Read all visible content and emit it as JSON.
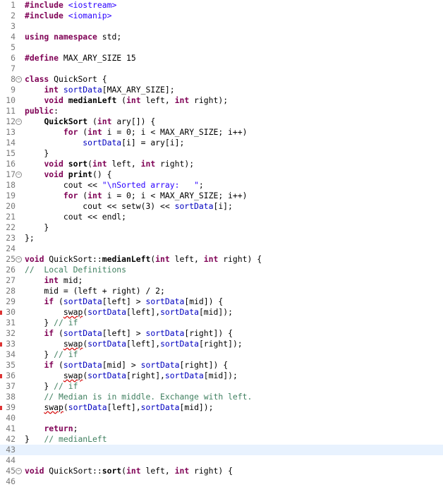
{
  "editor": {
    "lines": [
      {
        "n": "1",
        "fold": false,
        "marker": false,
        "current": false,
        "tokens": [
          [
            "pp",
            "#include"
          ],
          [
            "t",
            " "
          ],
          [
            "inc",
            "<iostream>"
          ]
        ]
      },
      {
        "n": "2",
        "fold": false,
        "marker": false,
        "current": false,
        "tokens": [
          [
            "pp",
            "#include"
          ],
          [
            "t",
            " "
          ],
          [
            "inc",
            "<iomanip>"
          ]
        ]
      },
      {
        "n": "3",
        "fold": false,
        "marker": false,
        "current": false,
        "tokens": []
      },
      {
        "n": "4",
        "fold": false,
        "marker": false,
        "current": false,
        "tokens": [
          [
            "kw",
            "using"
          ],
          [
            "t",
            " "
          ],
          [
            "kw",
            "namespace"
          ],
          [
            "t",
            " std;"
          ]
        ]
      },
      {
        "n": "5",
        "fold": false,
        "marker": false,
        "current": false,
        "tokens": []
      },
      {
        "n": "6",
        "fold": false,
        "marker": false,
        "current": false,
        "tokens": [
          [
            "pp",
            "#define"
          ],
          [
            "t",
            " MAX_ARY_SIZE 15"
          ]
        ]
      },
      {
        "n": "7",
        "fold": false,
        "marker": false,
        "current": false,
        "tokens": []
      },
      {
        "n": "8",
        "fold": true,
        "marker": false,
        "current": false,
        "tokens": [
          [
            "kw",
            "class"
          ],
          [
            "t",
            " QuickSort {"
          ]
        ]
      },
      {
        "n": "9",
        "fold": false,
        "marker": false,
        "current": false,
        "tokens": [
          [
            "t",
            "    "
          ],
          [
            "kw",
            "int"
          ],
          [
            "t",
            " "
          ],
          [
            "fld",
            "sortData"
          ],
          [
            "t",
            "["
          ],
          [
            "mac",
            "MAX_ARY_SIZE"
          ],
          [
            "t",
            "];"
          ]
        ]
      },
      {
        "n": "10",
        "fold": false,
        "marker": false,
        "current": false,
        "tokens": [
          [
            "t",
            "    "
          ],
          [
            "kw",
            "void"
          ],
          [
            "t",
            " "
          ],
          [
            "fn",
            "medianLeft"
          ],
          [
            "t",
            " ("
          ],
          [
            "kw",
            "int"
          ],
          [
            "t",
            " left, "
          ],
          [
            "kw",
            "int"
          ],
          [
            "t",
            " right);"
          ]
        ]
      },
      {
        "n": "11",
        "fold": false,
        "marker": false,
        "current": false,
        "tokens": [
          [
            "kw",
            "public"
          ],
          [
            "t",
            ":"
          ]
        ]
      },
      {
        "n": "12",
        "fold": true,
        "marker": false,
        "current": false,
        "tokens": [
          [
            "t",
            "    "
          ],
          [
            "fn",
            "QuickSort"
          ],
          [
            "t",
            " ("
          ],
          [
            "kw",
            "int"
          ],
          [
            "t",
            " ary[]) {"
          ]
        ]
      },
      {
        "n": "13",
        "fold": false,
        "marker": false,
        "current": false,
        "tokens": [
          [
            "t",
            "        "
          ],
          [
            "kw",
            "for"
          ],
          [
            "t",
            " ("
          ],
          [
            "kw",
            "int"
          ],
          [
            "t",
            " i = 0; i < "
          ],
          [
            "mac",
            "MAX_ARY_SIZE"
          ],
          [
            "t",
            "; i++)"
          ]
        ]
      },
      {
        "n": "14",
        "fold": false,
        "marker": false,
        "current": false,
        "tokens": [
          [
            "t",
            "            "
          ],
          [
            "fld",
            "sortData"
          ],
          [
            "t",
            "[i] = ary[i];"
          ]
        ]
      },
      {
        "n": "15",
        "fold": false,
        "marker": false,
        "current": false,
        "tokens": [
          [
            "t",
            "    }"
          ]
        ]
      },
      {
        "n": "16",
        "fold": false,
        "marker": false,
        "current": false,
        "tokens": [
          [
            "t",
            "    "
          ],
          [
            "kw",
            "void"
          ],
          [
            "t",
            " "
          ],
          [
            "fn",
            "sort"
          ],
          [
            "t",
            "("
          ],
          [
            "kw",
            "int"
          ],
          [
            "t",
            " left, "
          ],
          [
            "kw",
            "int"
          ],
          [
            "t",
            " right);"
          ]
        ]
      },
      {
        "n": "17",
        "fold": true,
        "marker": false,
        "current": false,
        "tokens": [
          [
            "t",
            "    "
          ],
          [
            "kw",
            "void"
          ],
          [
            "t",
            " "
          ],
          [
            "fn",
            "print"
          ],
          [
            "t",
            "() {"
          ]
        ]
      },
      {
        "n": "18",
        "fold": false,
        "marker": false,
        "current": false,
        "tokens": [
          [
            "t",
            "        cout << "
          ],
          [
            "str",
            "\"\\nSorted array:   \""
          ],
          [
            "t",
            ";"
          ]
        ]
      },
      {
        "n": "19",
        "fold": false,
        "marker": false,
        "current": false,
        "tokens": [
          [
            "t",
            "        "
          ],
          [
            "kw",
            "for"
          ],
          [
            "t",
            " ("
          ],
          [
            "kw",
            "int"
          ],
          [
            "t",
            " i = 0; i < "
          ],
          [
            "mac",
            "MAX_ARY_SIZE"
          ],
          [
            "t",
            "; i++)"
          ]
        ]
      },
      {
        "n": "20",
        "fold": false,
        "marker": false,
        "current": false,
        "tokens": [
          [
            "t",
            "            cout << setw(3) << "
          ],
          [
            "fld",
            "sortData"
          ],
          [
            "t",
            "[i];"
          ]
        ]
      },
      {
        "n": "21",
        "fold": false,
        "marker": false,
        "current": false,
        "tokens": [
          [
            "t",
            "        cout << endl;"
          ]
        ]
      },
      {
        "n": "22",
        "fold": false,
        "marker": false,
        "current": false,
        "tokens": [
          [
            "t",
            "    }"
          ]
        ]
      },
      {
        "n": "23",
        "fold": false,
        "marker": false,
        "current": false,
        "tokens": [
          [
            "t",
            "};"
          ]
        ]
      },
      {
        "n": "24",
        "fold": false,
        "marker": false,
        "current": false,
        "tokens": []
      },
      {
        "n": "25",
        "fold": true,
        "marker": false,
        "current": false,
        "tokens": [
          [
            "kw",
            "void"
          ],
          [
            "t",
            " QuickSort::"
          ],
          [
            "fn",
            "medianLeft"
          ],
          [
            "t",
            "("
          ],
          [
            "kw",
            "int"
          ],
          [
            "t",
            " left, "
          ],
          [
            "kw",
            "int"
          ],
          [
            "t",
            " right) {"
          ]
        ]
      },
      {
        "n": "26",
        "fold": false,
        "marker": false,
        "current": false,
        "tokens": [
          [
            "cmt",
            "//  Local Definitions"
          ]
        ]
      },
      {
        "n": "27",
        "fold": false,
        "marker": false,
        "current": false,
        "tokens": [
          [
            "t",
            "    "
          ],
          [
            "kw",
            "int"
          ],
          [
            "t",
            " mid;"
          ]
        ]
      },
      {
        "n": "28",
        "fold": false,
        "marker": false,
        "current": false,
        "tokens": [
          [
            "t",
            "    mid = (left + right) / 2;"
          ]
        ]
      },
      {
        "n": "29",
        "fold": false,
        "marker": false,
        "current": false,
        "tokens": [
          [
            "t",
            "    "
          ],
          [
            "kw",
            "if"
          ],
          [
            "t",
            " ("
          ],
          [
            "fld",
            "sortData"
          ],
          [
            "t",
            "[left] > "
          ],
          [
            "fld",
            "sortData"
          ],
          [
            "t",
            "[mid]) {"
          ]
        ]
      },
      {
        "n": "30",
        "fold": false,
        "marker": true,
        "current": false,
        "tokens": [
          [
            "t",
            "        "
          ],
          [
            "err",
            "swap"
          ],
          [
            "t",
            "("
          ],
          [
            "fld",
            "sortData"
          ],
          [
            "t",
            "[left],"
          ],
          [
            "fld",
            "sortData"
          ],
          [
            "t",
            "[mid]);"
          ]
        ]
      },
      {
        "n": "31",
        "fold": false,
        "marker": false,
        "current": false,
        "tokens": [
          [
            "t",
            "    } "
          ],
          [
            "cmt",
            "// if"
          ]
        ]
      },
      {
        "n": "32",
        "fold": false,
        "marker": false,
        "current": false,
        "tokens": [
          [
            "t",
            "    "
          ],
          [
            "kw",
            "if"
          ],
          [
            "t",
            " ("
          ],
          [
            "fld",
            "sortData"
          ],
          [
            "t",
            "[left] > "
          ],
          [
            "fld",
            "sortData"
          ],
          [
            "t",
            "[right]) {"
          ]
        ]
      },
      {
        "n": "33",
        "fold": false,
        "marker": true,
        "current": false,
        "tokens": [
          [
            "t",
            "        "
          ],
          [
            "err",
            "swap"
          ],
          [
            "t",
            "("
          ],
          [
            "fld",
            "sortData"
          ],
          [
            "t",
            "[left],"
          ],
          [
            "fld",
            "sortData"
          ],
          [
            "t",
            "[right]);"
          ]
        ]
      },
      {
        "n": "34",
        "fold": false,
        "marker": false,
        "current": false,
        "tokens": [
          [
            "t",
            "    } "
          ],
          [
            "cmt",
            "// if"
          ]
        ]
      },
      {
        "n": "35",
        "fold": false,
        "marker": false,
        "current": false,
        "tokens": [
          [
            "t",
            "    "
          ],
          [
            "kw",
            "if"
          ],
          [
            "t",
            " ("
          ],
          [
            "fld",
            "sortData"
          ],
          [
            "t",
            "[mid] > "
          ],
          [
            "fld",
            "sortData"
          ],
          [
            "t",
            "[right]) {"
          ]
        ]
      },
      {
        "n": "36",
        "fold": false,
        "marker": true,
        "current": false,
        "tokens": [
          [
            "t",
            "        "
          ],
          [
            "err",
            "swap"
          ],
          [
            "t",
            "("
          ],
          [
            "fld",
            "sortData"
          ],
          [
            "t",
            "[right],"
          ],
          [
            "fld",
            "sortData"
          ],
          [
            "t",
            "[mid]);"
          ]
        ]
      },
      {
        "n": "37",
        "fold": false,
        "marker": false,
        "current": false,
        "tokens": [
          [
            "t",
            "    } "
          ],
          [
            "cmt",
            "// if"
          ]
        ]
      },
      {
        "n": "38",
        "fold": false,
        "marker": false,
        "current": false,
        "tokens": [
          [
            "t",
            "    "
          ],
          [
            "cmt",
            "// Median is in middle. Exchange with left."
          ]
        ]
      },
      {
        "n": "39",
        "fold": false,
        "marker": true,
        "current": false,
        "tokens": [
          [
            "t",
            "    "
          ],
          [
            "err",
            "swap"
          ],
          [
            "t",
            "("
          ],
          [
            "fld",
            "sortData"
          ],
          [
            "t",
            "[left],"
          ],
          [
            "fld",
            "sortData"
          ],
          [
            "t",
            "[mid]);"
          ]
        ]
      },
      {
        "n": "40",
        "fold": false,
        "marker": false,
        "current": false,
        "tokens": []
      },
      {
        "n": "41",
        "fold": false,
        "marker": false,
        "current": false,
        "tokens": [
          [
            "t",
            "    "
          ],
          [
            "kw",
            "return"
          ],
          [
            "t",
            ";"
          ]
        ]
      },
      {
        "n": "42",
        "fold": false,
        "marker": false,
        "current": false,
        "tokens": [
          [
            "t",
            "}   "
          ],
          [
            "cmt",
            "// medianLeft"
          ]
        ]
      },
      {
        "n": "43",
        "fold": false,
        "marker": false,
        "current": true,
        "tokens": []
      },
      {
        "n": "44",
        "fold": false,
        "marker": false,
        "current": false,
        "tokens": []
      },
      {
        "n": "45",
        "fold": true,
        "marker": false,
        "current": false,
        "tokens": [
          [
            "kw",
            "void"
          ],
          [
            "t",
            " QuickSort::"
          ],
          [
            "fn",
            "sort"
          ],
          [
            "t",
            "("
          ],
          [
            "kw",
            "int"
          ],
          [
            "t",
            " left, "
          ],
          [
            "kw",
            "int"
          ],
          [
            "t",
            " right) {"
          ]
        ]
      },
      {
        "n": "46",
        "fold": false,
        "marker": false,
        "current": false,
        "tokens": []
      }
    ]
  }
}
